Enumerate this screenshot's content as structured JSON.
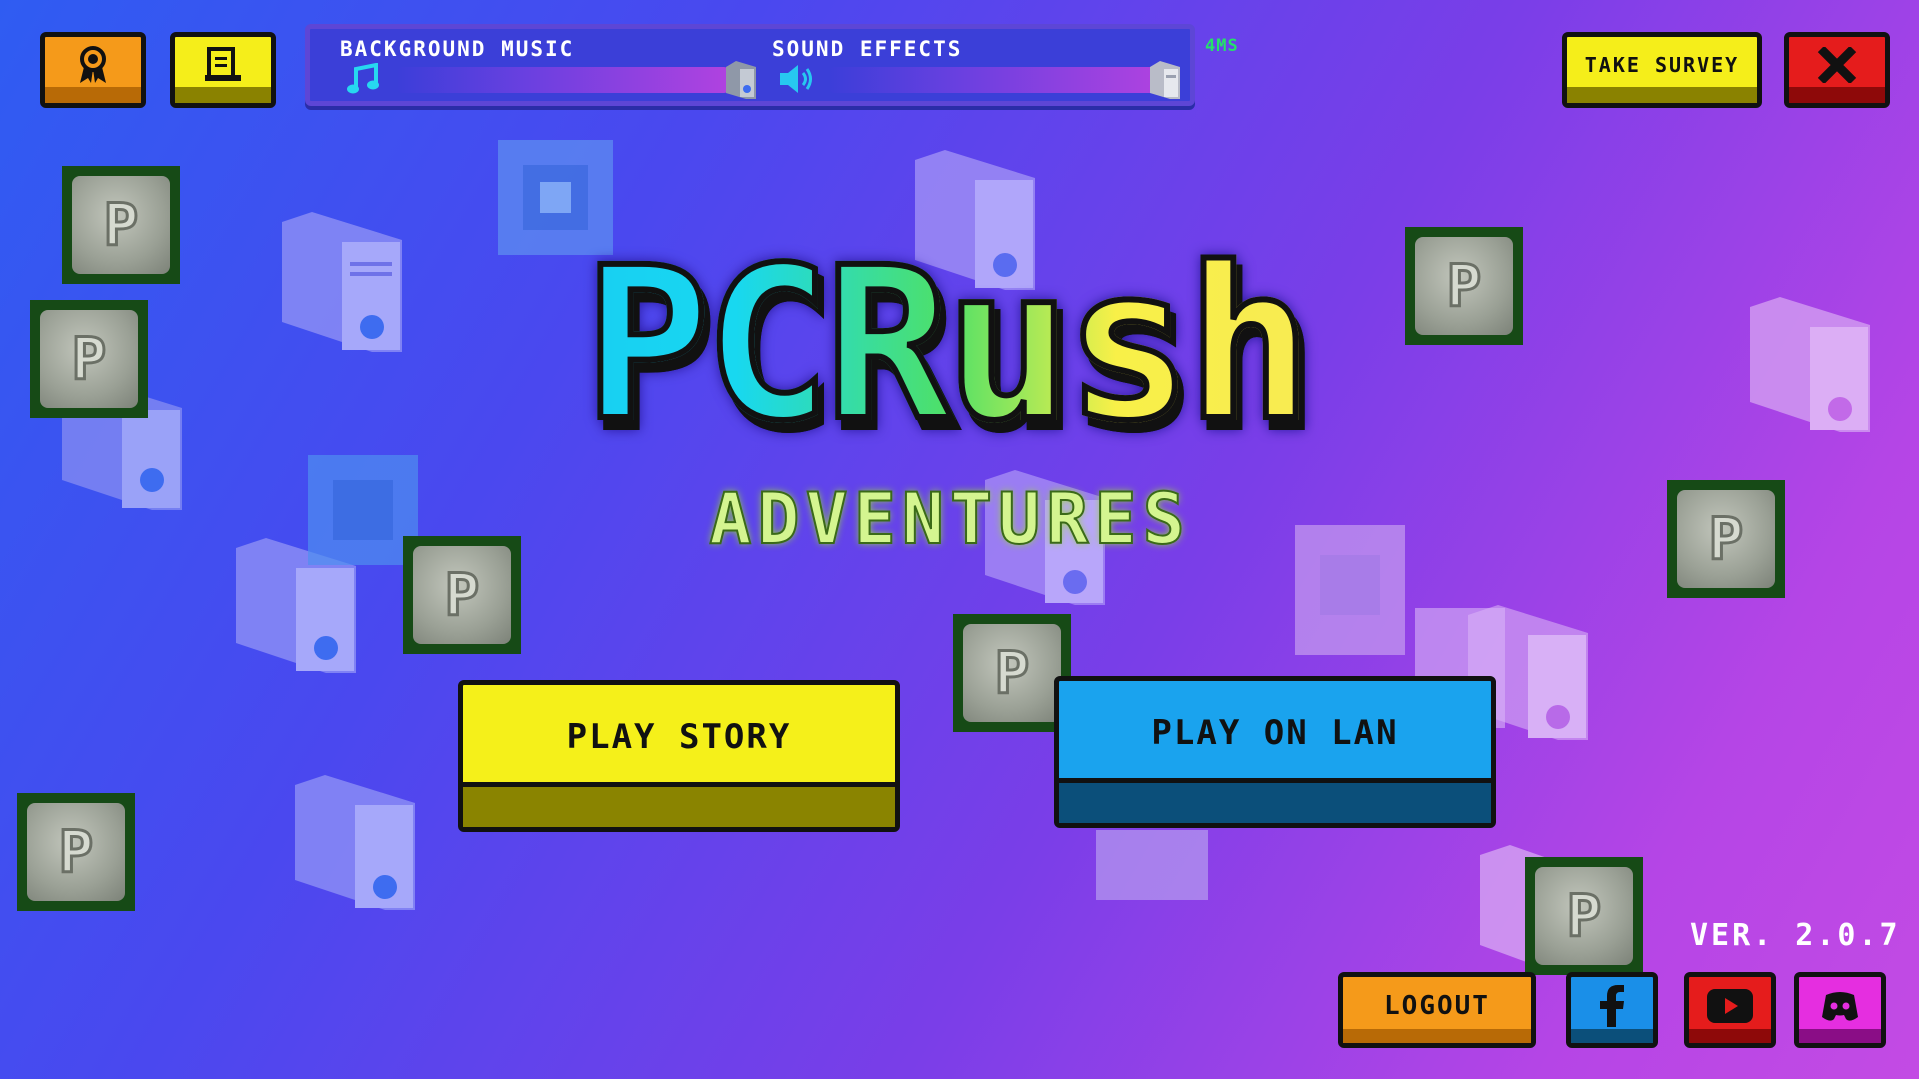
{
  "top_bar": {
    "award_icon": "award-ribbon-icon",
    "scroll_icon": "scroll-icon",
    "background_music_label": "BACKGROUND MUSIC",
    "sound_effects_label": "SOUND EFFECTS",
    "ping": "4MS",
    "survey_label": "TAKE SURVEY",
    "close_icon": "close-x-icon",
    "music_volume": 1.0,
    "sfx_volume": 1.0
  },
  "title": {
    "main": "PCRush",
    "sub": "ADVENTURES"
  },
  "menu": {
    "play_story": "PLAY STORY",
    "play_on_lan": "PLAY ON LAN"
  },
  "footer": {
    "version": "VER. 2.0.7",
    "logout": "LOGOUT",
    "facebook_icon": "facebook-icon",
    "youtube_icon": "youtube-icon",
    "discord_icon": "discord-icon"
  },
  "coins": {
    "letter": "P"
  },
  "colors": {
    "yellow": "#f5f01a",
    "orange": "#f59a1a",
    "red": "#e51c1c",
    "blue": "#1aa3ee",
    "magenta": "#e52ee0",
    "ping_green": "#25e06a"
  }
}
